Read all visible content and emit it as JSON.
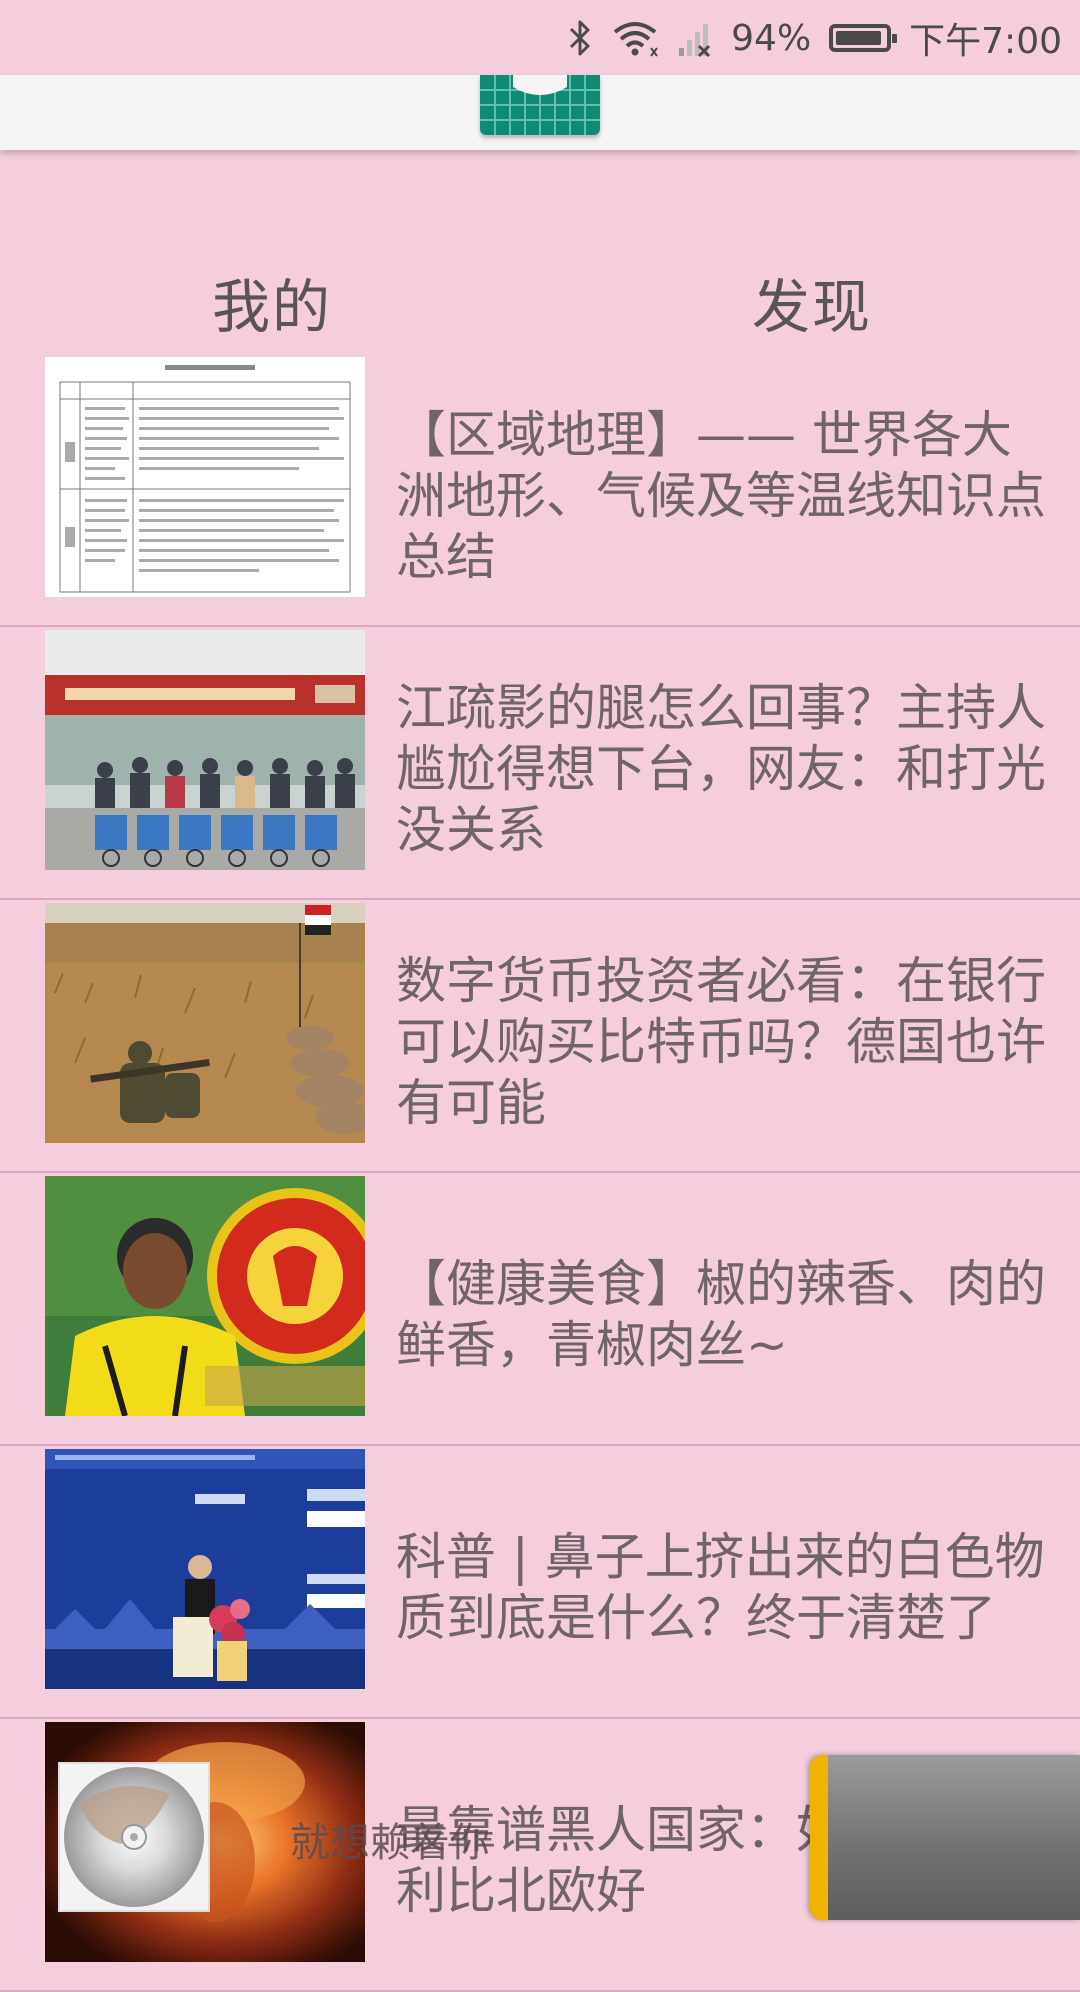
{
  "status_bar": {
    "battery": "94%",
    "battery_level": 0.94,
    "time": "下午7:00",
    "icons": [
      "bluetooth-icon",
      "wifi-icon",
      "signal-icon",
      "battery-icon"
    ]
  },
  "tabs": [
    {
      "label": "我的"
    },
    {
      "label": "发现"
    }
  ],
  "news": [
    {
      "title": "【区域地理】—— 世界各大洲地形、气候及等温线知识点总结",
      "thumb": "document-table-thumbnail"
    },
    {
      "title": "江疏影的腿怎么回事？主持人尴尬得想下台，网友：和打光没关系",
      "thumb": "group-photo-banner-thumbnail"
    },
    {
      "title": "数字货币投资者必看：在银行可以购买比特币吗？德国也许有可能",
      "thumb": "soldiers-desert-thumbnail"
    },
    {
      "title": "【健康美食】椒的辣香、肉的鲜香，青椒肉丝~",
      "thumb": "football-player-thumbnail"
    },
    {
      "title": "科普 | 鼻子上挤出来的白色物质到底是什么？终于清楚了",
      "thumb": "speech-stage-thumbnail"
    },
    {
      "title": "最靠谱黑人国家：奴隶制，福利比北欧好",
      "thumb": "explosion-thumbnail"
    }
  ],
  "player": {
    "text": "就想赖着你"
  },
  "colors": {
    "background": "#f4cedd",
    "toolbar": "#f5f5f5",
    "logo": "#0f8a73",
    "divider": "#dba9bd",
    "accent": "#f0b400"
  }
}
